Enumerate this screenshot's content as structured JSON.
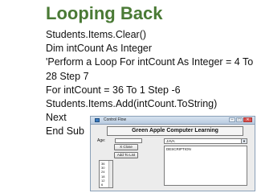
{
  "slide": {
    "title": "Looping Back",
    "code_lines": [
      "Students.Items.Clear()",
      "Dim intCount As Integer",
      "'Perform a Loop For intCount As Integer = 4 To 28 Step  7",
      "For intCount = 36 To 1 Step -6",
      "Students.Items.Add(intCount.ToString)",
      "Next",
      "End Sub"
    ]
  },
  "window": {
    "title": "Control Flow",
    "heading": "Green Apple  Computer Learning",
    "age_label": "Age:",
    "language_select": "JAVA",
    "close_label": "X Close",
    "add_label": "Add To List",
    "description_label": "DESCRIPTION",
    "list_items": [
      "36",
      "30",
      "24",
      "18",
      "12",
      "6"
    ],
    "colors": {
      "title_green": "#4a7a35",
      "titlebar": "#c7d6e8"
    }
  }
}
